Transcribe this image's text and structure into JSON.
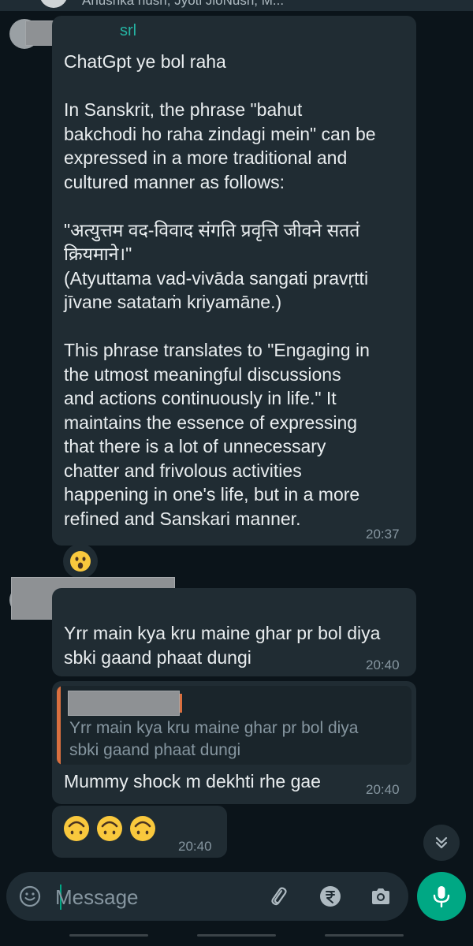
{
  "header": {
    "members": "Anushka nush, Jyoti JioNush, M..."
  },
  "messages": [
    {
      "sender": "srl",
      "text": "ChatGpt ye bol raha\n\nIn Sanskrit, the phrase \"bahut\nbakchodi ho raha zindagi mein\" can be\nexpressed in a more traditional and\ncultured manner as follows:\n\n\"अत्युत्तम वद-विवाद संगति प्रवृत्ति जीवने सततं\nक्रियमाने।\"\n(Atyuttama vad-vivāda sangati pravṛtti\njīvane satataṁ kriyamāne.)\n\nThis phrase translates to \"Engaging in\nthe utmost meaningful discussions\nand actions continuously in life.\" It\nmaintains the essence of expressing\nthat there is a lot of unnecessary\nchatter and frivolous activities\nhappening in one's life, but in a more\nrefined and Sanskari manner.",
      "time": "20:37",
      "reaction": "astonished-face"
    },
    {
      "text": "Yrr main kya kru maine ghar pr bol diya\nsbki gaand phaat dungi",
      "time": "20:40"
    },
    {
      "quoted_text": "Yrr main kya kru maine ghar pr bol diya\nsbki gaand phaat dungi",
      "text": "Mummy shock m dekhti rhe gae",
      "time": "20:40"
    },
    {
      "emojis": [
        "upside-down-face",
        "upside-down-face",
        "upside-down-face"
      ],
      "time": "20:40"
    }
  ],
  "composer": {
    "placeholder": "Message"
  },
  "colors": {
    "background": "#0b141a",
    "bubble": "#202c33",
    "accent": "#00a884",
    "sender_name": "#25b4a3",
    "quote_bar": "#d96f3f"
  },
  "icons": [
    "emoji-icon",
    "attach-icon",
    "rupee-icon",
    "camera-icon",
    "mic-icon",
    "chevron-double-down-icon"
  ]
}
